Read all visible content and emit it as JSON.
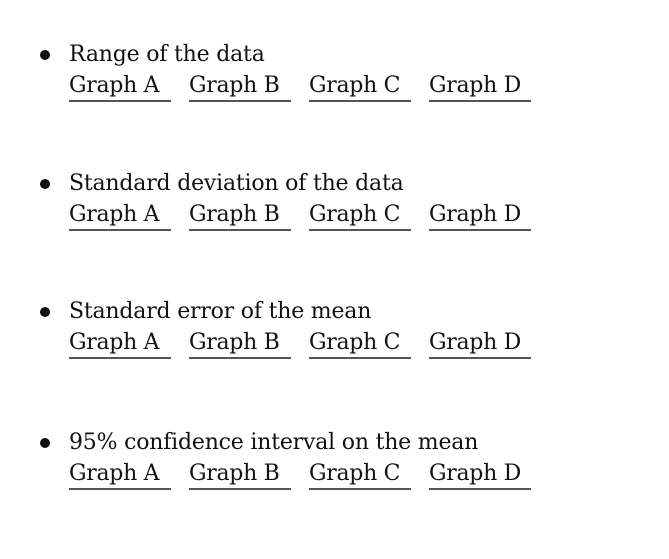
{
  "questions": [
    {
      "prompt": "Range of the data",
      "options": [
        "Graph A",
        "Graph B",
        "Graph C",
        "Graph D"
      ]
    },
    {
      "prompt": "Standard deviation of the data",
      "options": [
        "Graph A",
        "Graph B",
        "Graph C",
        "Graph D"
      ]
    },
    {
      "prompt": "Standard error of the mean",
      "options": [
        "Graph A",
        "Graph B",
        "Graph C",
        "Graph D"
      ]
    },
    {
      "prompt": "95% confidence interval on the mean",
      "options": [
        "Graph A",
        "Graph B",
        "Graph C",
        "Graph D"
      ]
    }
  ]
}
